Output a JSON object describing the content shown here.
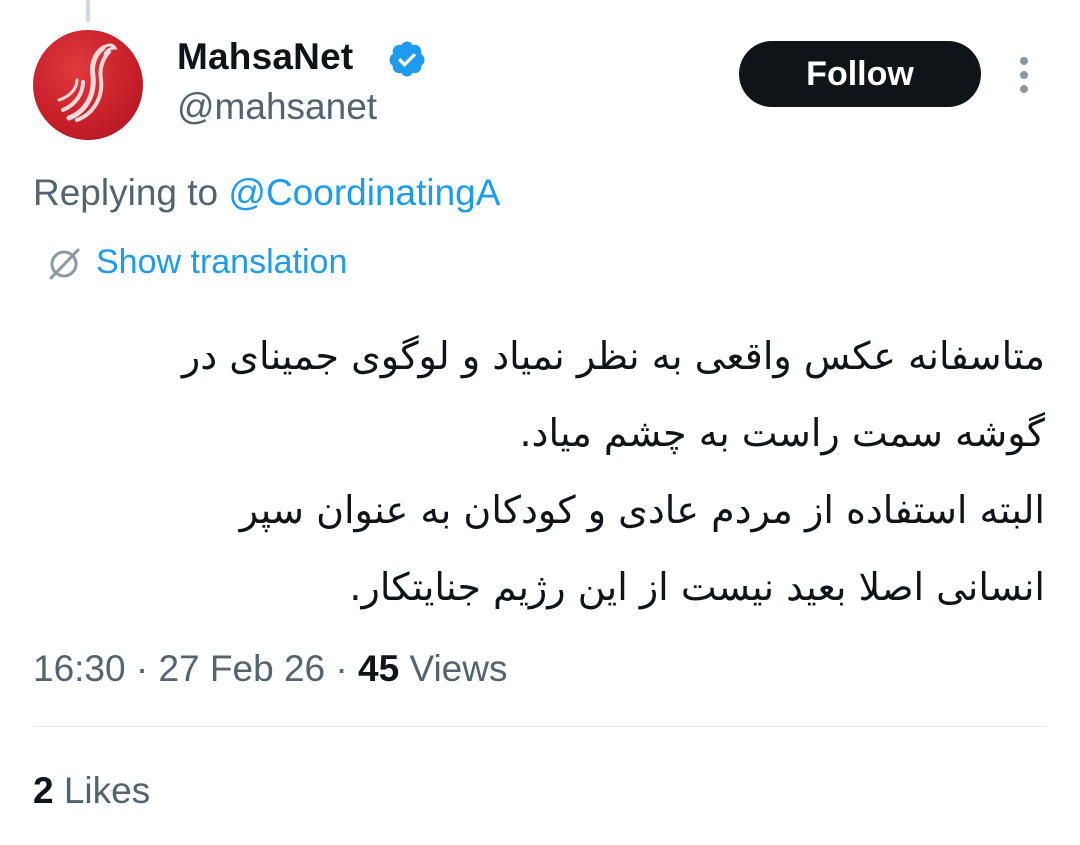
{
  "author": {
    "display_name": "MahsaNet",
    "handle": "@mahsanet",
    "verified": true,
    "avatar_color": "#c8202a"
  },
  "follow_button": {
    "label": "Follow"
  },
  "more_button": {
    "icon": "more-vertical-icon"
  },
  "reply_context": {
    "prefix": "Replying to ",
    "mention": "@CoordinatingA"
  },
  "translation": {
    "icon": "translate-globe-icon",
    "label": "Show translation"
  },
  "tweet": {
    "lines": [
      "متاسفانه عکس واقعی به نظر نمیاد و لوگوی جمینای در",
      "گوشه سمت راست به چشم میاد.",
      "البته استفاده از مردم عادی و کودکان به عنوان سپر",
      "انسانی اصلا بعید نیست از این رژیم جنایتکار."
    ]
  },
  "meta": {
    "time": "16:30",
    "separator": " · ",
    "date": "27 Feb 26",
    "views_count": "45",
    "views_label": " Views"
  },
  "stats": {
    "likes_count": "2",
    "likes_label": " Likes"
  },
  "colors": {
    "accent": "#1d9bf0",
    "text_primary": "#0f1419",
    "text_secondary": "#536471",
    "button_bg": "#0f1419"
  }
}
